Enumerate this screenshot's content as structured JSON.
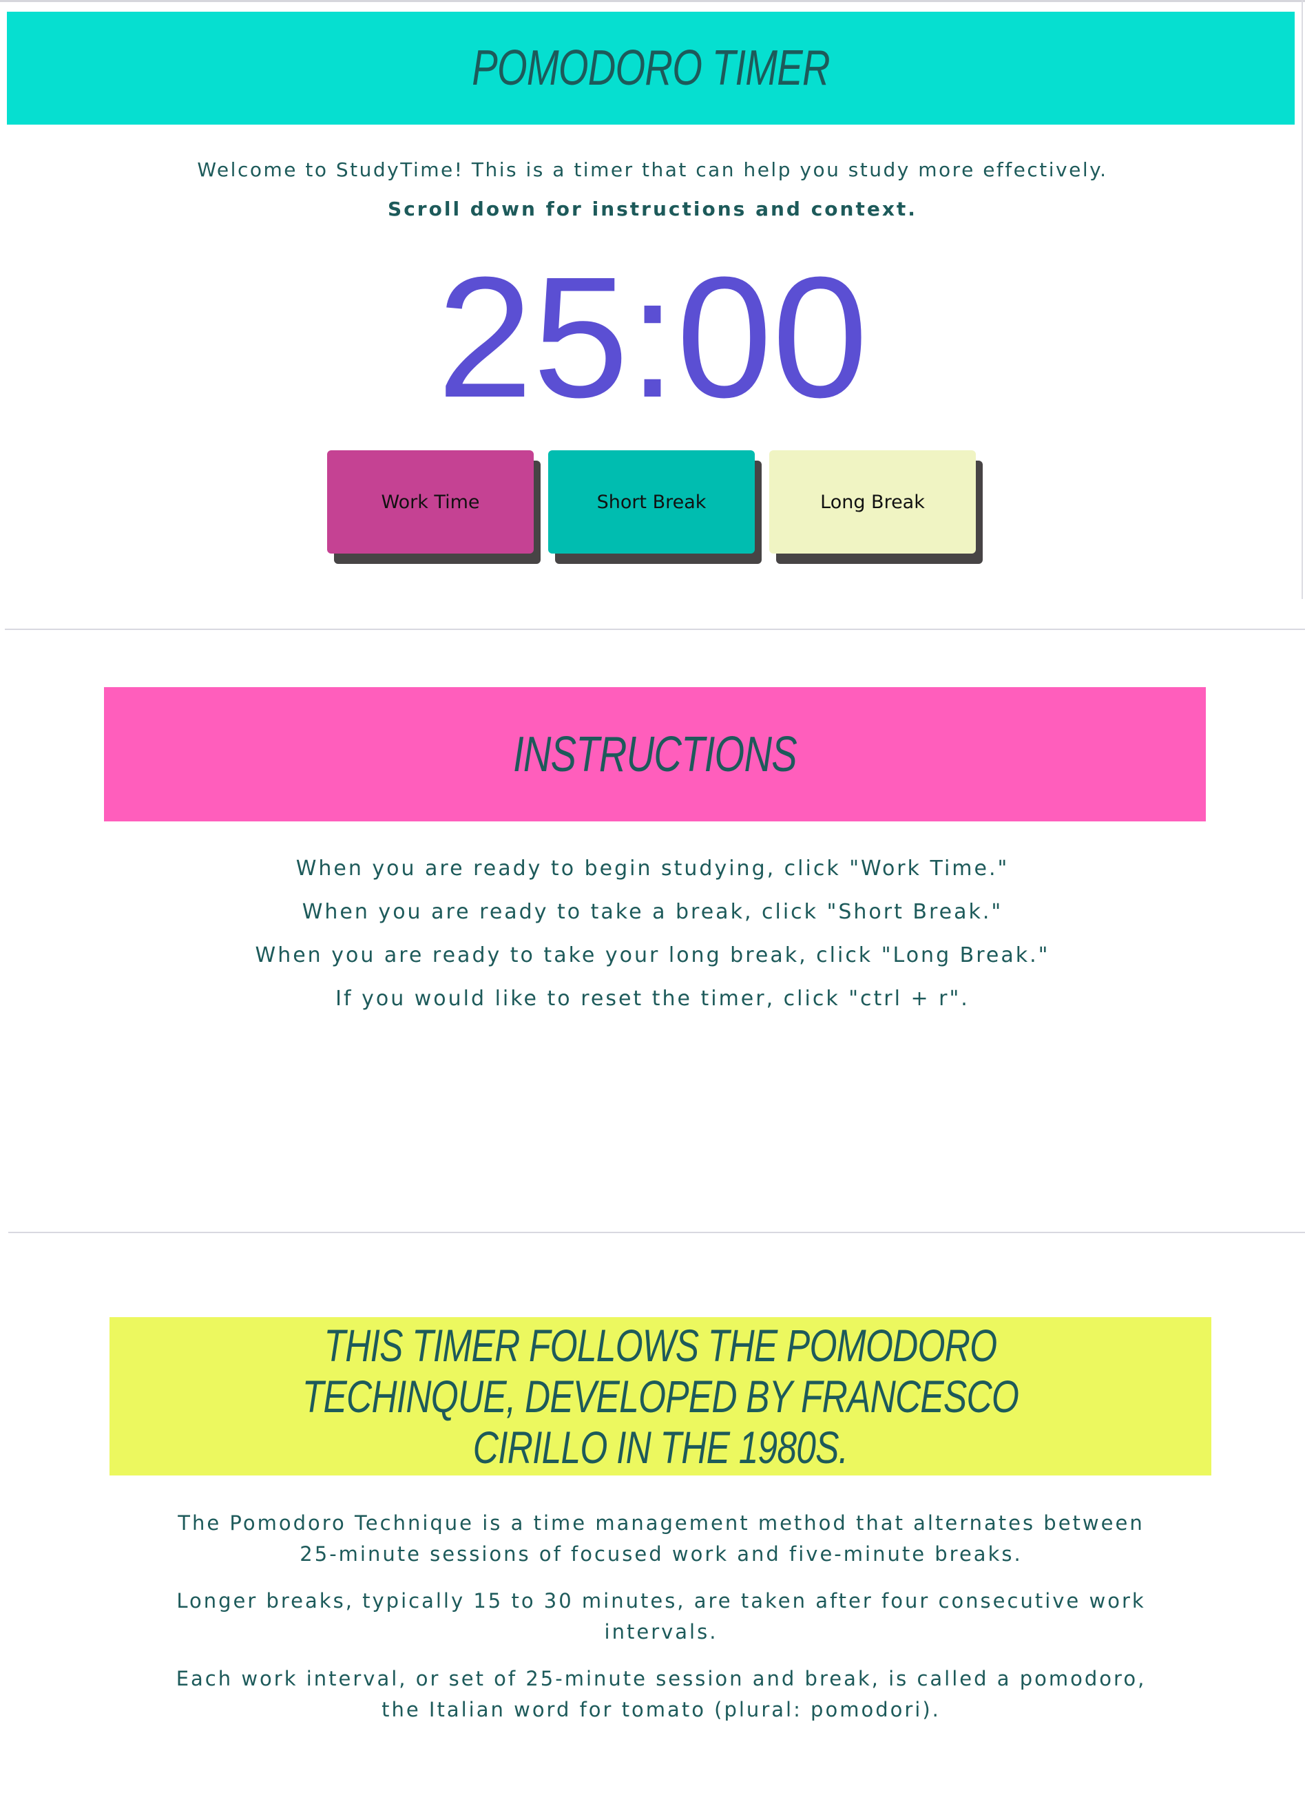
{
  "colors": {
    "header_banner": "#06dfd0",
    "instructions_banner": "#ff5ebc",
    "context_banner": "#ecf85f",
    "heading_text": "#1d5a5a",
    "timer_text": "#5b4fd3",
    "work_button": "#c54293",
    "short_break_button": "#00bdb0",
    "long_break_button": "#f0f4c3",
    "button_shadow": "#474445"
  },
  "header": {
    "title": "Pomodoro Timer"
  },
  "intro": {
    "line1": "Welcome to StudyTime! This is a timer that can help you study more effectively.",
    "line2": "Scroll down for instructions and context."
  },
  "timer": {
    "display": "25:00"
  },
  "buttons": {
    "work": "Work Time",
    "short_break": "Short Break",
    "long_break": "Long Break"
  },
  "instructions": {
    "title": "Instructions",
    "lines": [
      "When you are ready to begin studying, click \"Work Time.\"",
      "When you are ready to take a break, click \"Short Break.\"",
      "When you are ready to take your long break, click \"Long Break.\"",
      "If you would like to reset the timer, click \"ctrl + r\"."
    ]
  },
  "context": {
    "title": "This timer follows the Pomodoro Techinque, developed by Francesco Cirillo in the 1980s.",
    "paragraphs": [
      "The Pomodoro Technique is a time management method that alternates between 25-minute sessions of focused work and five-minute breaks.",
      "Longer breaks, typically 15 to 30 minutes, are taken after four consecutive work intervals.",
      "Each work interval, or set of 25-minute session and break, is called a pomodoro, the Italian word for tomato (plural: pomodori)."
    ]
  }
}
